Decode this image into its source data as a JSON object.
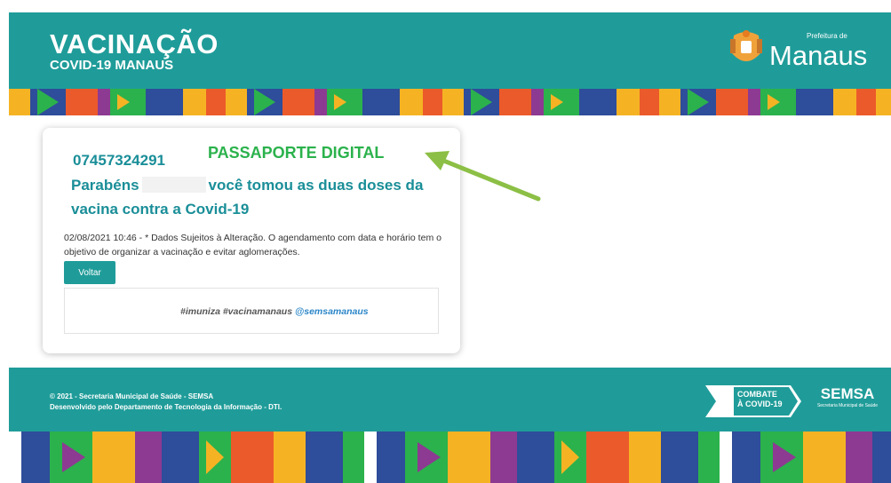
{
  "header": {
    "title": "VACINAÇÃO",
    "subtitle": "COVID-19 MANAUS",
    "city_small": "Prefeitura de",
    "city_name": "Manaus"
  },
  "card": {
    "id_number": "07457324291",
    "passport_label": "PASSAPORTE DIGITAL",
    "congrats_prefix": "Parabéns",
    "congrats_suffix": "você tomou as duas doses da vacina contra a Covid-19",
    "timestamp": "02/08/2021 10:46",
    "note": " - * Dados Sujeitos à Alteração. O agendamento com data e horário tem o objetivo de organizar a vacinação e evitar aglomerações.",
    "back_label": "Voltar",
    "hashtags": "#imuniza #vacinamanaus",
    "mention": "@semsamanaus"
  },
  "footer": {
    "line1": "© 2021 - Secretaria Municipal de Saúde - SEMSA",
    "line2": "Desenvolvido pelo Departamento de Tecnologia da Informação - DTI.",
    "combate_line1": "COMBATE",
    "combate_line2": "À COVID-19",
    "semsa": "SEMSA",
    "semsa_sub": "Secretaria Municipal de Saúde"
  },
  "colors": {
    "teal": "#1f9c99",
    "heading_teal": "#1a8e98",
    "green": "#2bb24c",
    "arrow": "#8cbf45",
    "mention_blue": "#2a86c8"
  },
  "icons": [
    "crest-icon",
    "arrow-annotation",
    "combate-flag-icon"
  ]
}
